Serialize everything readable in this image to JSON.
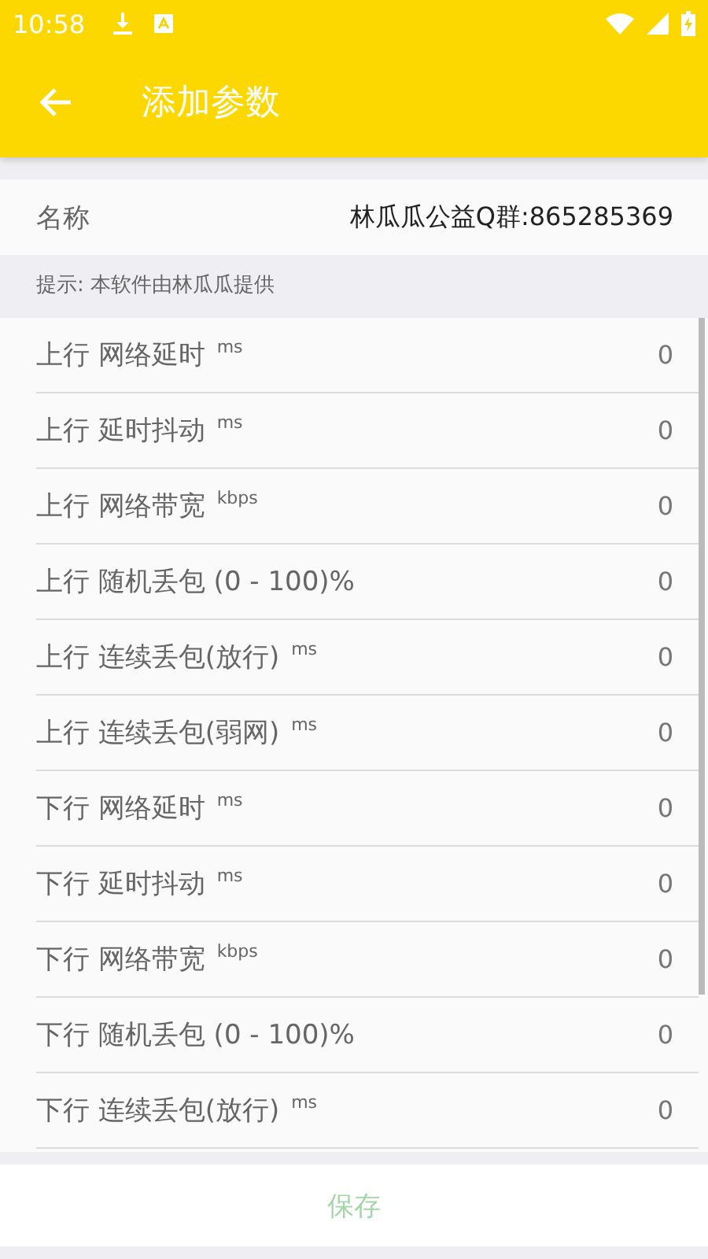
{
  "status_bar": {
    "time": "10:58"
  },
  "app_bar": {
    "title": "添加参数"
  },
  "name_row": {
    "label": "名称",
    "value": "林瓜瓜公益Q群:865285369"
  },
  "hint": "提示: 本软件由林瓜瓜提供",
  "params": [
    {
      "label": "上行 网络延时 $^{ms}$",
      "value": "0"
    },
    {
      "label": "上行 延时抖动 $^{ms}$",
      "value": "0"
    },
    {
      "label": "上行 网络带宽 $^{kbps}$",
      "value": "0"
    },
    {
      "label": "上行 随机丢包 (0 - 100)%",
      "value": "0"
    },
    {
      "label": "上行 连续丢包(放行) $^{ms}$",
      "value": "0"
    },
    {
      "label": "上行 连续丢包(弱网) $^{ms}$",
      "value": "0"
    },
    {
      "label": "下行 网络延时 $^{ms}$",
      "value": "0"
    },
    {
      "label": "下行 延时抖动 $^{ms}$",
      "value": "0"
    },
    {
      "label": "下行 网络带宽 $^{kbps}$",
      "value": "0"
    },
    {
      "label": "下行 随机丢包 (0 - 100)%",
      "value": "0"
    },
    {
      "label": "下行 连续丢包(放行) $^{ms}$",
      "value": "0"
    }
  ],
  "save_button": {
    "label": "保存"
  }
}
